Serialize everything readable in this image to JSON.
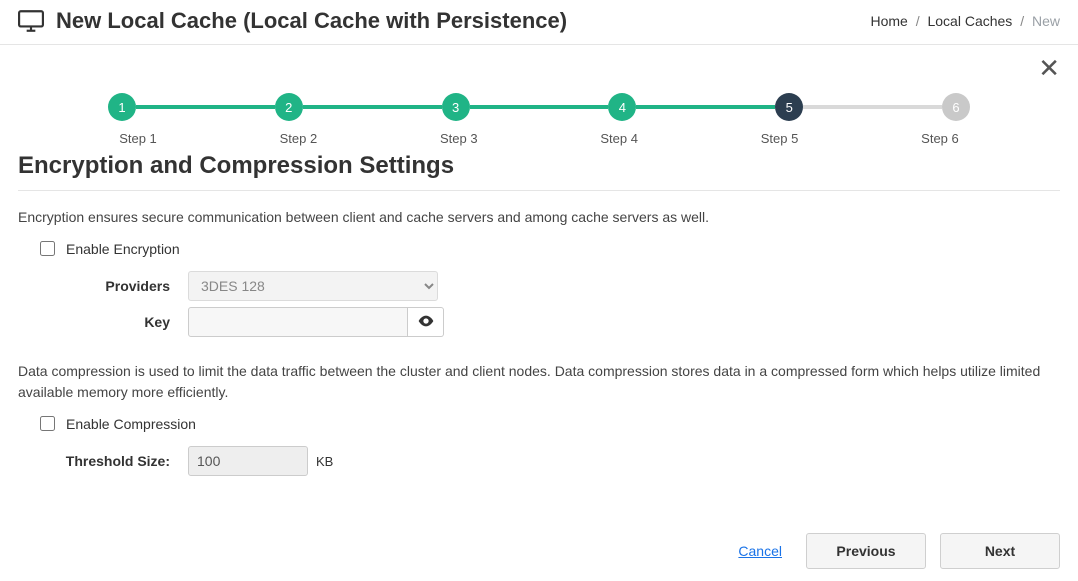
{
  "header": {
    "title": "New Local Cache (Local Cache with Persistence)",
    "breadcrumb": {
      "home": "Home",
      "mid": "Local Caches",
      "current": "New"
    }
  },
  "close_label": "✕",
  "stepper": {
    "steps": [
      {
        "num": "1",
        "label": "Step 1",
        "state": "done"
      },
      {
        "num": "2",
        "label": "Step 2",
        "state": "done"
      },
      {
        "num": "3",
        "label": "Step 3",
        "state": "done"
      },
      {
        "num": "4",
        "label": "Step 4",
        "state": "done"
      },
      {
        "num": "5",
        "label": "Step 5",
        "state": "active"
      },
      {
        "num": "6",
        "label": "Step 6",
        "state": "todo"
      }
    ]
  },
  "section": {
    "title": "Encryption and Compression Settings",
    "encryption_desc": "Encryption ensures secure communication between client and cache servers and among cache servers as well.",
    "enable_encryption_label": "Enable Encryption",
    "providers_label": "Providers",
    "providers_value": "3DES 128",
    "key_label": "Key",
    "key_value": "",
    "compression_desc": "Data compression is used to limit the data traffic between the cluster and client nodes. Data compression stores data in a compressed form which helps utilize limited available memory more efficiently.",
    "enable_compression_label": "Enable Compression",
    "threshold_label": "Threshold Size:",
    "threshold_value": "100",
    "threshold_unit": "KB"
  },
  "footer": {
    "cancel": "Cancel",
    "previous": "Previous",
    "next": "Next"
  }
}
